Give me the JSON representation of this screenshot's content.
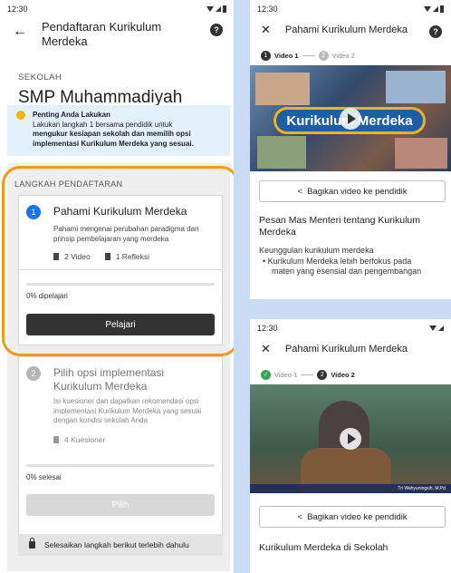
{
  "left": {
    "status_time": "12:30",
    "title": "Pendaftaran Kurikulum Merdeka",
    "help_icon": "?",
    "back_icon": "←",
    "school_label": "SEKOLAH",
    "school_name": "SMP Muhammadiyah",
    "banner_title": "Penting Anda Lakukan",
    "banner_text_1": "Lakukan langkah 1 bersama pendidik untuk",
    "banner_text_2": "mengukur kesiapan sekolah dan memilih opsi",
    "banner_text_3": "implementasi Kurikulum Merdeka yang sesuai.",
    "steps_label": "LANGKAH PENDAFTARAN",
    "step1": {
      "num": "1",
      "title": "Pahami Kurikulum Merdeka",
      "desc": "Pahami mengenai perubahan paradigma dan prinsip pembelajaran yang merdeka",
      "meta_1": "2 Video",
      "meta_2": "1 Refleksi",
      "progress_text": "0% dipelajari",
      "progress": 0,
      "button": "Pelajari"
    },
    "step2": {
      "num": "2",
      "title": "Pilih opsi implementasi Kurikulum Merdeka",
      "desc": "Isi kuesioner dan dapatkan rekomendasi opsi implementasi Kurikulum Merdeka yang sesuai dengan kondisi sekolah Anda",
      "meta_1": "4 Kuesioner",
      "progress_text": "0% selesai",
      "progress": 0,
      "button": "Pilih"
    },
    "lock_text": "Selesaikan langkah berikut terlebih dahulu",
    "accent": "#1a73e8",
    "highlight": "#f39a14"
  },
  "video1": {
    "status_time": "12:30",
    "title": "Pahami Kurikulum Merdeka",
    "close_icon": "✕",
    "help_icon": "?",
    "step1_num": "1",
    "step1_label": "Video 1",
    "step2_num": "2",
    "step2_label": "Video 2",
    "banner_text": "Kurikulum Merdeka",
    "share_label": "Bagikan video ke pendidik",
    "heading": "Pesan Mas Menteri tentang Kurikulum Merdeka",
    "body_1": "Keunggulan kurikulum merdeka",
    "bullet_1": "Kurikulum Merdeka lebih berfokus pada",
    "bullet_2": "materi yang esensial dan pengembangan"
  },
  "video2": {
    "status_time": "12:30",
    "title": "Pahami Kurikulum Merdeka",
    "close_icon": "✕",
    "step1_label": "Video 1",
    "step1_check": "✓",
    "step2_num": "2",
    "step2_label": "Video 2",
    "caption": "Tri Wahyuningsih, M.Pd",
    "share_label": "Bagikan video ke pendidik",
    "heading": "Kurikulum Merdeka di Sekolah"
  }
}
